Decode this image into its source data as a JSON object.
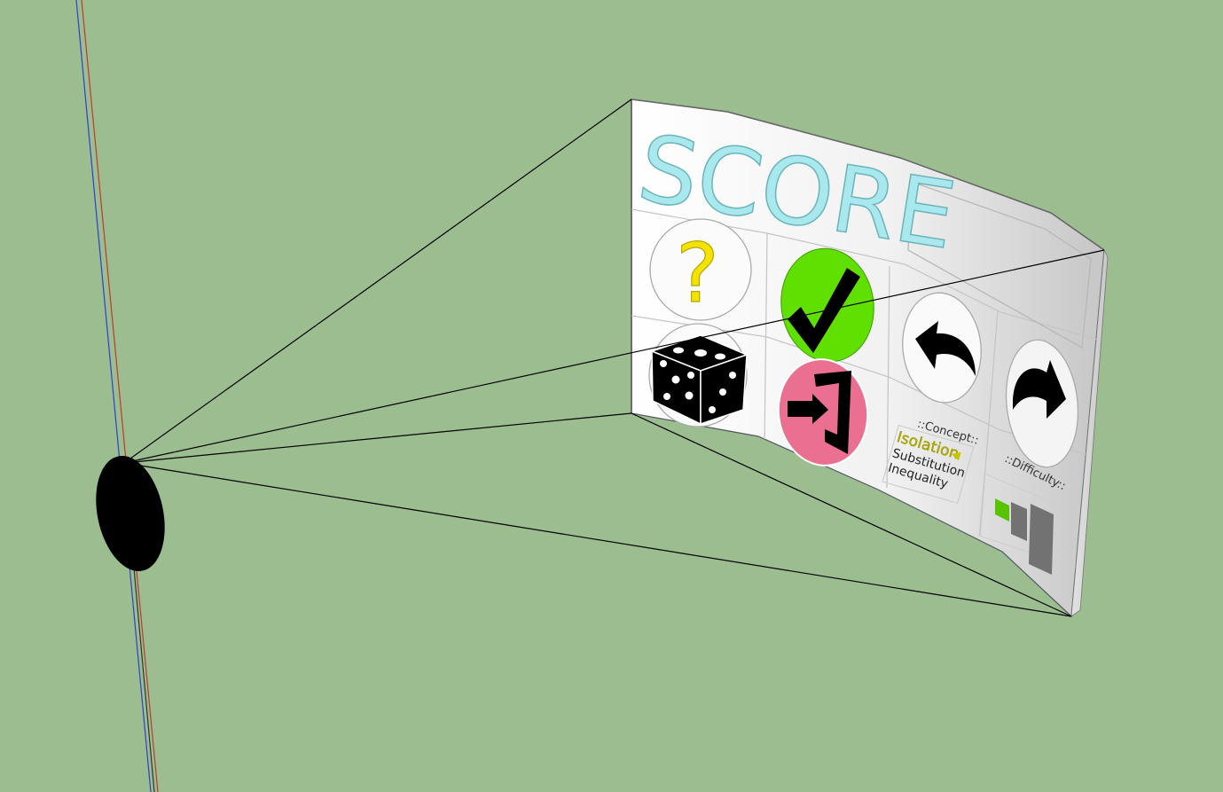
{
  "colors": {
    "background": "#9bbd90",
    "score_text": "#a9e8ec",
    "help_mark": "#f4e300",
    "confirm_green": "#5fe000",
    "exit_pink": "#ea6f90",
    "difficulty_active": "#58c400",
    "difficulty_inactive": "#727272",
    "axis_blue": "#2d3fd0",
    "axis_red": "#c0392b"
  },
  "panel": {
    "title": "SCORE",
    "score_value": "",
    "buttons": {
      "help_icon": "question-mark-icon",
      "help_glyph": "?",
      "confirm_icon": "checkmark-icon",
      "random_icon": "dice-icon",
      "exit_icon": "exit-door-icon",
      "undo_icon": "undo-arrow-icon",
      "redo_icon": "redo-arrow-icon"
    },
    "concept": {
      "header": "::Concept::",
      "items": [
        "Isolation",
        "Substitution",
        "Inequality"
      ],
      "selected_marker": "◀"
    },
    "difficulty": {
      "header": "::Difficulty::",
      "level": 1,
      "max": 3
    }
  }
}
